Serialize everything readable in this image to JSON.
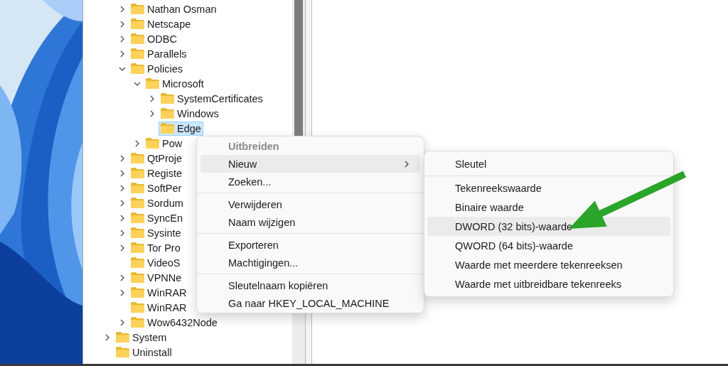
{
  "tree": {
    "items": [
      {
        "children": [
          {
            "label": "Nathan Osman",
            "expanded": false,
            "selected": false
          },
          {
            "label": "Netscape",
            "expanded": false,
            "selected": false
          },
          {
            "label": "ODBC",
            "expanded": false,
            "selected": false
          },
          {
            "label": "Parallels",
            "expanded": false,
            "selected": false
          },
          {
            "label": "Policies",
            "expanded": true,
            "selected": false,
            "children": [
              {
                "label": "Microsoft",
                "expanded": true,
                "selected": false,
                "children": [
                  {
                    "label": "SystemCertificates",
                    "expanded": false,
                    "selected": false
                  },
                  {
                    "label": "Windows",
                    "expanded": false,
                    "selected": false
                  },
                  {
                    "label": "Edge",
                    "selected": true
                  }
                ]
              },
              {
                "label": "Pow",
                "expanded": false,
                "selected": false
              }
            ]
          },
          {
            "label": "QtProje",
            "expanded": false,
            "selected": false
          },
          {
            "label": "Registe",
            "expanded": false,
            "selected": false
          },
          {
            "label": "SoftPer",
            "expanded": false,
            "selected": false
          },
          {
            "label": "Sordum",
            "expanded": false,
            "selected": false
          },
          {
            "label": "SyncEn",
            "expanded": false,
            "selected": false
          },
          {
            "label": "Sysinte",
            "expanded": false,
            "selected": false
          },
          {
            "label": "Tor Pro",
            "expanded": false,
            "selected": false
          },
          {
            "label": "VideoS",
            "selected": false
          },
          {
            "label": "VPNNe",
            "expanded": false,
            "selected": false
          },
          {
            "label": "WinRAR",
            "expanded": false,
            "selected": false
          },
          {
            "label": "WinRAR",
            "selected": false
          },
          {
            "label": "Wow6432Node",
            "expanded": false,
            "selected": false
          }
        ]
      },
      {
        "label": "System",
        "expanded": false,
        "selected": false
      },
      {
        "label": "Uninstall",
        "selected": false
      }
    ]
  },
  "context_menu": {
    "items": [
      {
        "kind": "header",
        "label": "Uitbreiden"
      },
      {
        "kind": "item",
        "label": "Nieuw",
        "selected": true,
        "submenu": true
      },
      {
        "kind": "item",
        "label": "Zoeken...",
        "selected": false
      },
      {
        "kind": "separator"
      },
      {
        "kind": "item",
        "label": "Verwijderen",
        "selected": false
      },
      {
        "kind": "item",
        "label": "Naam wijzigen",
        "selected": false
      },
      {
        "kind": "separator"
      },
      {
        "kind": "item",
        "label": "Exporteren",
        "selected": false
      },
      {
        "kind": "item",
        "label": "Machtigingen...",
        "selected": false
      },
      {
        "kind": "separator"
      },
      {
        "kind": "item",
        "label": "Sleutelnaam kopiëren",
        "selected": false
      },
      {
        "kind": "item",
        "label": "Ga naar HKEY_LOCAL_MACHINE",
        "selected": false
      }
    ]
  },
  "submenu": {
    "items": [
      {
        "kind": "item",
        "label": "Sleutel",
        "selected": false
      },
      {
        "kind": "separator"
      },
      {
        "kind": "item",
        "label": "Tekenreekswaarde",
        "selected": false
      },
      {
        "kind": "item",
        "label": "Binaire waarde",
        "selected": false
      },
      {
        "kind": "item",
        "label": "DWORD (32 bits)-waarde",
        "selected": true
      },
      {
        "kind": "item",
        "label": "QWORD (64 bits)-waarde",
        "selected": false
      },
      {
        "kind": "item",
        "label": "Waarde met meerdere tekenreeksen",
        "selected": false
      },
      {
        "kind": "item",
        "label": "Waarde met uitbreidbare tekenreeks",
        "selected": false
      }
    ]
  }
}
